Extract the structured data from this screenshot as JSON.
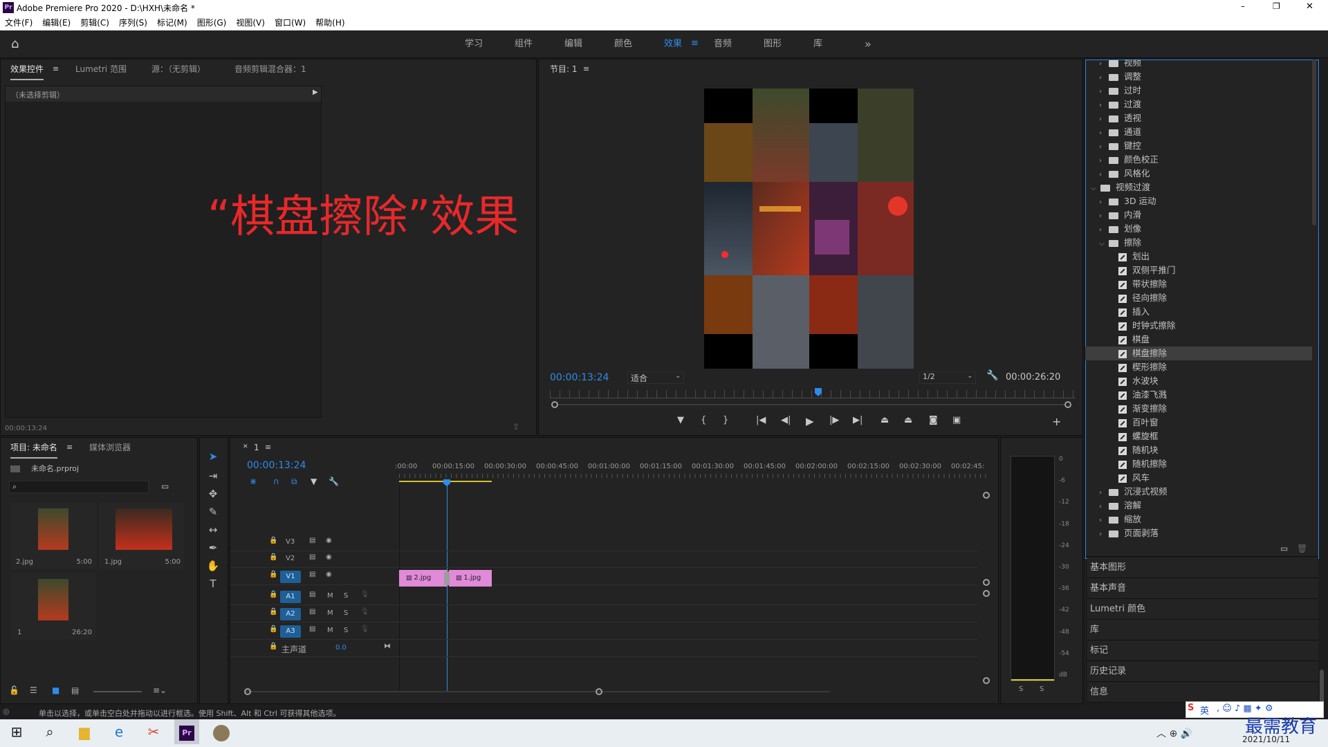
{
  "app": {
    "icon_text": "Pr",
    "title": "Adobe Premiere Pro 2020 - D:\\HXH\\未命名 *"
  },
  "window_controls": {
    "minimize": "–",
    "maximize": "❐",
    "close": "✕"
  },
  "menu": [
    "文件(F)",
    "编辑(E)",
    "剪辑(C)",
    "序列(S)",
    "标记(M)",
    "图形(G)",
    "视图(V)",
    "窗口(W)",
    "帮助(H)"
  ],
  "workspaces": {
    "tabs": [
      "学习",
      "组件",
      "编辑",
      "颜色",
      "效果",
      "音频",
      "图形",
      "库"
    ],
    "active": "效果",
    "more": "»"
  },
  "source_panel": {
    "tabs": [
      "效果控件",
      "Lumetri 范围",
      "源：（无剪辑）",
      "音频剪辑混合器：1"
    ],
    "no_clip": "（未选择剪辑）",
    "timecode": "00:00:13:24"
  },
  "overlay_caption": "“棋盘擦除”效果",
  "program_monitor": {
    "tab": "节目: 1",
    "timecode": "00:00:13:24",
    "fit": "适合",
    "resolution": "1/2",
    "duration": "00:00:26:20"
  },
  "project_panel": {
    "tabs": [
      "项目: 未命名",
      "媒体浏览器"
    ],
    "project_file": "未命名.prproj",
    "items": [
      {
        "name": "2.jpg",
        "duration": "5:00"
      },
      {
        "name": "1.jpg",
        "duration": "5:00"
      },
      {
        "name": "1",
        "duration": "26:20"
      }
    ]
  },
  "timeline": {
    "tab": "1",
    "timecode": "00:00:13:24",
    "ruler": [
      ":00:00",
      "00:00:15:00",
      "00:00:30:00",
      "00:00:45:00",
      "00:01:00:00",
      "00:01:15:00",
      "00:01:30:00",
      "00:01:45:00",
      "00:02:00:00",
      "00:02:15:00",
      "00:02:30:00",
      "00:02:45:"
    ],
    "video_tracks": [
      "V3",
      "V2",
      "V1"
    ],
    "audio_tracks": [
      "A1",
      "A2",
      "A3"
    ],
    "master": {
      "label": "主声道",
      "value": "0.0"
    },
    "clips": [
      {
        "name": "2.jpg"
      },
      {
        "name": "1.jpg"
      }
    ],
    "audio_buttons": {
      "mute": "M",
      "solo": "S"
    }
  },
  "meter": {
    "scale": [
      "0",
      "-6",
      "-12",
      "-18",
      "-24",
      "-30",
      "-36",
      "-42",
      "-48",
      "-54",
      "dB"
    ],
    "solo": [
      "S",
      "S"
    ]
  },
  "effects_tree": [
    {
      "label": "视频",
      "type": "folder",
      "level": 1
    },
    {
      "label": "调整",
      "type": "folder",
      "level": 1
    },
    {
      "label": "过时",
      "type": "folder",
      "level": 1
    },
    {
      "label": "过渡",
      "type": "folder",
      "level": 1
    },
    {
      "label": "透视",
      "type": "folder",
      "level": 1
    },
    {
      "label": "通道",
      "type": "folder",
      "level": 1
    },
    {
      "label": "键控",
      "type": "folder",
      "level": 1
    },
    {
      "label": "颜色校正",
      "type": "folder",
      "level": 1
    },
    {
      "label": "风格化",
      "type": "folder",
      "level": 1
    },
    {
      "label": "视频过渡",
      "type": "folder-open",
      "level": 0
    },
    {
      "label": "3D 运动",
      "type": "folder",
      "level": 1
    },
    {
      "label": "内滑",
      "type": "folder",
      "level": 1
    },
    {
      "label": "划像",
      "type": "folder",
      "level": 1
    },
    {
      "label": "擦除",
      "type": "folder-open",
      "level": 1
    },
    {
      "label": "划出",
      "type": "effect",
      "level": 2
    },
    {
      "label": "双侧平推门",
      "type": "effect",
      "level": 2
    },
    {
      "label": "带状擦除",
      "type": "effect",
      "level": 2
    },
    {
      "label": "径向擦除",
      "type": "effect",
      "level": 2
    },
    {
      "label": "插入",
      "type": "effect",
      "level": 2
    },
    {
      "label": "时钟式擦除",
      "type": "effect",
      "level": 2
    },
    {
      "label": "棋盘",
      "type": "effect",
      "level": 2
    },
    {
      "label": "棋盘擦除",
      "type": "effect",
      "level": 2,
      "selected": true
    },
    {
      "label": "楔形擦除",
      "type": "effect",
      "level": 2
    },
    {
      "label": "水波块",
      "type": "effect",
      "level": 2
    },
    {
      "label": "油漆飞溅",
      "type": "effect",
      "level": 2
    },
    {
      "label": "渐变擦除",
      "type": "effect",
      "level": 2
    },
    {
      "label": "百叶窗",
      "type": "effect",
      "level": 2
    },
    {
      "label": "螺旋框",
      "type": "effect",
      "level": 2
    },
    {
      "label": "随机块",
      "type": "effect",
      "level": 2
    },
    {
      "label": "随机擦除",
      "type": "effect",
      "level": 2
    },
    {
      "label": "风车",
      "type": "effect",
      "level": 2
    },
    {
      "label": "沉浸式视频",
      "type": "folder",
      "level": 1
    },
    {
      "label": "溶解",
      "type": "folder",
      "level": 1
    },
    {
      "label": "缩放",
      "type": "folder",
      "level": 1
    },
    {
      "label": "页面剥落",
      "type": "folder",
      "level": 1
    }
  ],
  "lower_panels": [
    "基本图形",
    "基本声音",
    "Lumetri 颜色",
    "库",
    "标记",
    "历史记录",
    "信息"
  ],
  "status_bar": "单击以选择，或单击空白处并拖动以进行框选。使用 Shift、Alt 和 Ctrl 可获得其他选项。",
  "taskbar": {
    "watermark": "最需教育",
    "ime": "英",
    "date": "2021/10/11"
  },
  "colors": {
    "accent": "#2d8ceb",
    "caption": "#e8282a",
    "clip": "#e08ad8",
    "track_active": "#1e5f96"
  }
}
